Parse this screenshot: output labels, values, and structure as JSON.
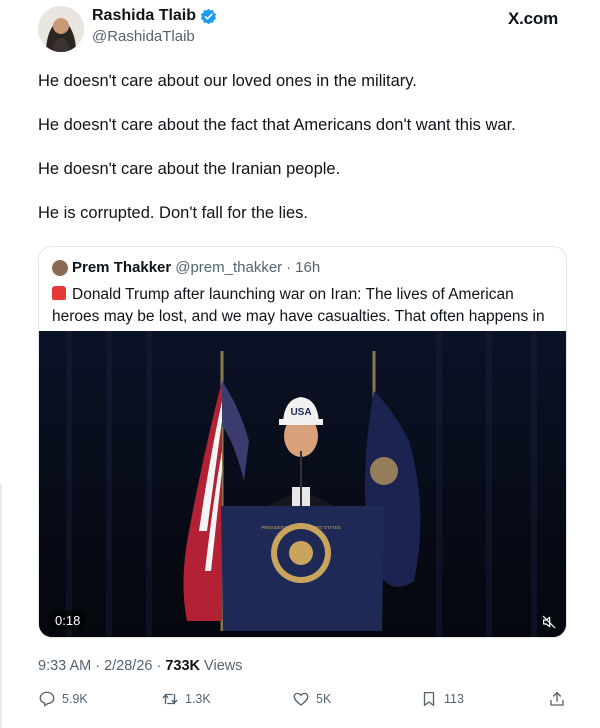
{
  "author": {
    "name": "Rashida Tlaib",
    "handle": "@RashidaTlaib"
  },
  "site_label": "X.com",
  "tweet_lines": [
    "He doesn't care about our loved ones in the military.",
    "He doesn't care about the fact that Americans don't want this war.",
    "He doesn't care about the Iranian people.",
    "He is corrupted. Don't fall for the lies."
  ],
  "quote": {
    "name": "Prem Thakker",
    "handle": "@prem_thakker",
    "separator": "·",
    "age": "16h",
    "text": "Donald Trump after launching war on Iran: The lives of American heroes may be lost, and we may have casualties. That often happens in war.",
    "video": {
      "timer": "0:18",
      "cap_text": "USA",
      "seal_text": "PRESIDENT OF THE UNITED STATES"
    }
  },
  "meta": {
    "time_date": "9:33 AM · 2/28/26 · ",
    "views_count": "733K",
    "views_label": " Views"
  },
  "actions": {
    "replies": "5.9K",
    "reposts": "1.3K",
    "likes": "5K",
    "bookmarks": "113"
  },
  "colors": {
    "verified": "#1d9bf0",
    "muted_text": "#536471",
    "border": "#e3e7ea"
  },
  "icons": [
    "verified-badge-icon",
    "siren-icon",
    "mute-icon",
    "reply-icon",
    "repost-icon",
    "like-icon",
    "bookmark-icon",
    "share-icon"
  ]
}
